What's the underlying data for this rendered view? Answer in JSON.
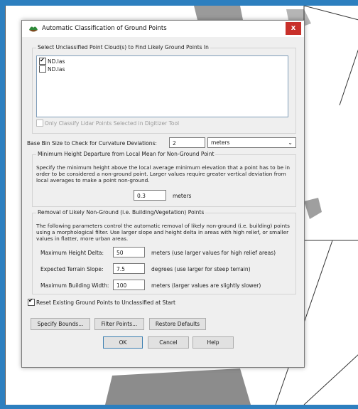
{
  "dialog": {
    "title": "Automatic Classification of Ground Points",
    "close_label": "x",
    "cloud_group": {
      "title": "Select Unclassified Point Cloud(s) to Find Likely Ground Points In",
      "items": [
        {
          "label": "ND.las",
          "checked": true
        },
        {
          "label": "ND.las",
          "checked": false
        }
      ],
      "only_classify_label": "Only Classify Lidar Points Selected in Digitizer Tool"
    },
    "bin_size": {
      "label": "Base Bin Size to Check for Curvature Deviations:",
      "value": "2",
      "unit": "meters"
    },
    "min_height_group": {
      "title": "Minimum Height Departure from Local Mean for Non-Ground Point",
      "description": "Specify the minimum height above the local average minimum elevation that a point has to be in order to be considered a non-ground point. Larger values require greater vertical deviation from local averages to make a point non-ground.",
      "value": "0.3",
      "unit": "meters"
    },
    "removal_group": {
      "title": "Removal of Likely Non-Ground (i.e. Building/Vegetation) Points",
      "description": "The following parameters control the automatic removal of likely non-ground (i.e. building) points using a morphological filter. Use larger slope and height delta in areas with high relief, or smaller values in flatter, more urban areas.",
      "max_height_delta": {
        "label": "Maximum Height Delta:",
        "value": "50",
        "note": "meters (use larger values for high relief areas)"
      },
      "terrain_slope": {
        "label": "Expected Terrain Slope:",
        "value": "7.5",
        "note": "degrees (use larger for steep terrain)"
      },
      "building_width": {
        "label": "Maximum Building Width:",
        "value": "100",
        "note": "meters (larger values are slightly slower)"
      }
    },
    "reset_label": "Reset Existing Ground Points to Unclassified at Start",
    "reset_checked": true,
    "buttons": {
      "specify_bounds": "Specify Bounds...",
      "filter_points": "Filter Points...",
      "restore_defaults": "Restore Defaults",
      "ok": "OK",
      "cancel": "Cancel",
      "help": "Help"
    }
  }
}
